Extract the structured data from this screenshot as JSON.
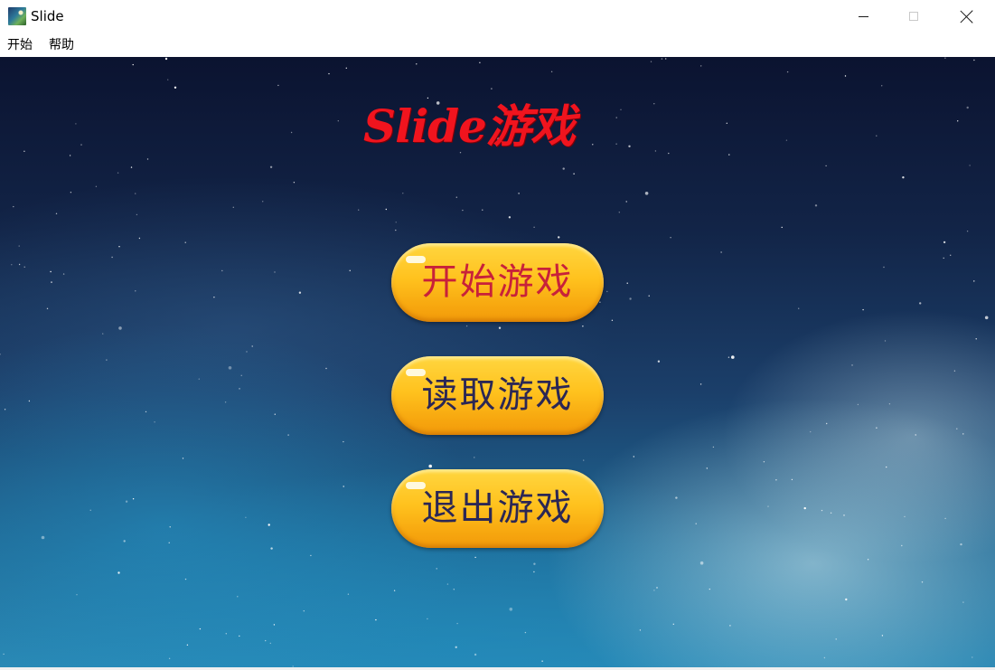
{
  "window": {
    "title": "Slide",
    "icon": "app-landscape-icon"
  },
  "menubar": {
    "start": "开始",
    "help": "帮助"
  },
  "game": {
    "title": "Slide游戏",
    "buttons": {
      "start": "开始游戏",
      "load": "读取游戏",
      "quit": "退出游戏"
    }
  },
  "colors": {
    "title_red": "#f0141e",
    "button_gold": "#ffc21e",
    "start_label": "#c8213a",
    "other_labels": "#2b2755",
    "sky_dark": "#0b1330",
    "sky_light": "#2a88b4"
  }
}
